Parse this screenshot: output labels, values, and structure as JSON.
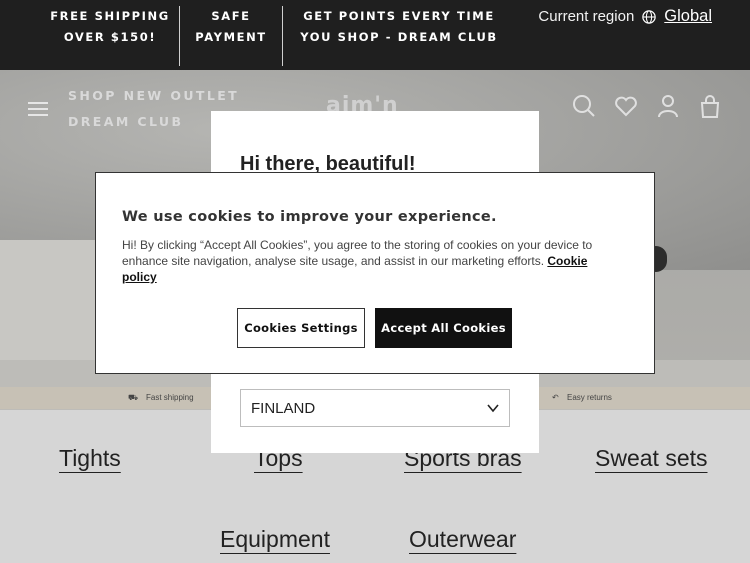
{
  "topbar": {
    "promo1": "FREE SHIPPING OVER $150!",
    "promo2": "SAFE PAYMENT",
    "promo3": "GET POINTS EVERY TIME YOU SHOP - DREAM CLUB",
    "region_label": "Current region",
    "region_value": "Global"
  },
  "nav": {
    "item1": "SHOP NEW OUTLET",
    "item2": "DREAM CLUB",
    "logo": "aim'n"
  },
  "icons": {
    "menu": "hamburger-icon",
    "search": "search-icon",
    "wishlist": "heart-icon",
    "account": "user-icon",
    "cart": "bag-icon",
    "globe": "globe-icon"
  },
  "strip": {
    "shipping": "Fast shipping",
    "returns": "Easy returns"
  },
  "modal": {
    "greeting": "Hi there, beautiful!",
    "country_selected": "FINLAND"
  },
  "cookie": {
    "heading": "We use cookies to improve your experience.",
    "body": "Hi! By clicking “Accept All Cookies”, you agree to the storing of cookies on your device to enhance site navigation, analyse site usage, and assist in our marketing efforts.",
    "policy_link": "Cookie policy",
    "settings_button": "Cookies Settings",
    "accept_button": "Accept All Cookies"
  },
  "categories": [
    "Tights",
    "Tops",
    "Sports bras",
    "Sweat sets",
    "Equipment",
    "Outerwear"
  ],
  "colors": {
    "topbar_bg": "#1f1f1f",
    "accept_bg": "#111111"
  }
}
